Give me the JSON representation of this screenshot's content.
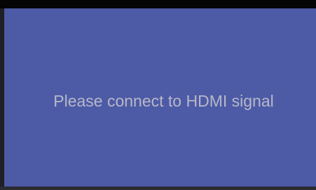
{
  "screen": {
    "message": "Please connect to HDMI signal",
    "background_color": "#4d5aa6",
    "text_color": "#b7b8c7"
  }
}
